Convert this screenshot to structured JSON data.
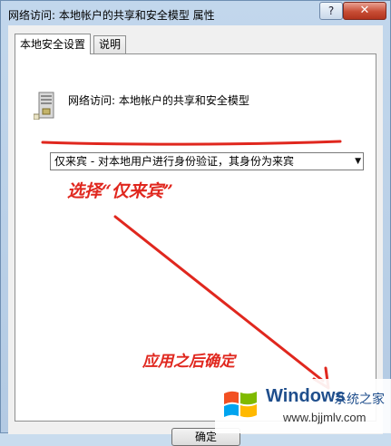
{
  "window": {
    "title": "网络访问: 本地帐户的共享和安全模型 属性",
    "help_label": "?",
    "close_label": "✕"
  },
  "tabs": [
    {
      "label": "本地安全设置",
      "active": true
    },
    {
      "label": "说明",
      "active": false
    }
  ],
  "policy": {
    "icon": "server-icon",
    "name": "网络访问: 本地帐户的共享和安全模型"
  },
  "combo": {
    "selected": "仅来宾 - 对本地用户进行身份验证，其身份为来宾",
    "arrow": "▼"
  },
  "annotations": {
    "select_note": "选择“仅来宾”",
    "apply_note": "应用之后确定",
    "color": "#e0271e"
  },
  "buttons": {
    "ok_label": "确定"
  },
  "watermark": {
    "brand": "Windows",
    "brand_cn": "系统之家",
    "url": "www.bjjmlv.com"
  }
}
